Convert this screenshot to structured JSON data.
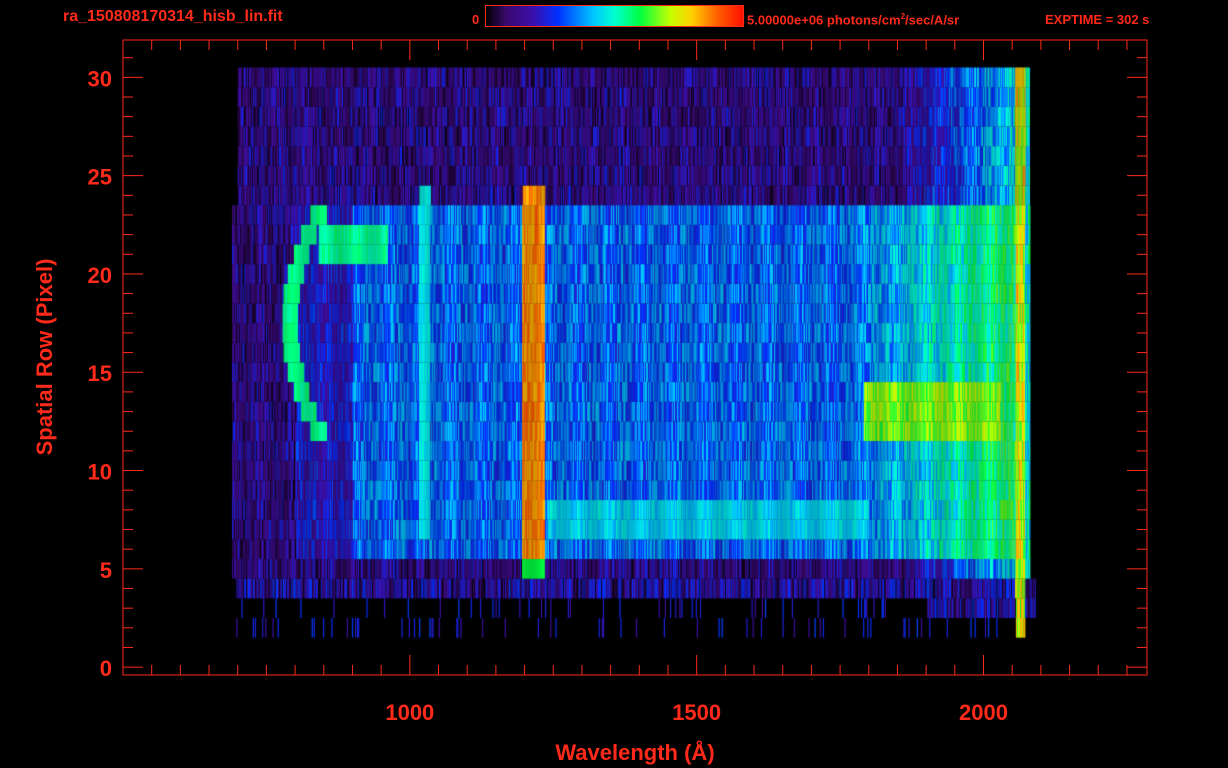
{
  "header": {
    "filename": "ra_150808170314_hisb_lin.fit",
    "colorbar_min": "0",
    "colorbar_max": "5.00000e+06 photons/cm",
    "colorbar_units_sup": "2",
    "colorbar_units_rest": "/sec/A/sr",
    "exptime": "EXPTIME = 302 s"
  },
  "chart_data": {
    "type": "heatmap",
    "title": "ra_150808170314_hisb_lin.fit",
    "xlabel": "Wavelength (Å)",
    "ylabel": "Spatial Row (Pixel)",
    "xlim": [
      500,
      2285
    ],
    "ylim": [
      -0.4,
      31.9
    ],
    "x_ticks": [
      1000,
      1500,
      2000
    ],
    "x_tick_labels": [
      "1000",
      "1500",
      "2000"
    ],
    "x_minor_step": 50,
    "y_ticks": [
      0,
      5,
      10,
      15,
      20,
      25,
      30
    ],
    "y_tick_labels": [
      "0",
      "5",
      "10",
      "15",
      "20",
      "25",
      "30"
    ],
    "color_range": [
      0,
      5000000
    ],
    "colormap": "rainbow",
    "rows": 31,
    "data_extent_wavelength": [
      690,
      2090
    ],
    "features": [
      {
        "name": "slit background",
        "wavelength": [
          690,
          2080
        ],
        "rows": [
          5,
          30
        ],
        "level": 0.15
      },
      {
        "name": "slit illuminated region",
        "wavelength": [
          780,
          2065
        ],
        "rows": [
          6,
          23
        ],
        "level": 0.36
      },
      {
        "name": "Lyman alpha 1216",
        "wavelength": [
          1195,
          1235
        ],
        "rows": [
          5,
          24
        ],
        "level": 0.92
      },
      {
        "name": "Lyman beta 1026",
        "wavelength": [
          1015,
          1035
        ],
        "rows": [
          7,
          24
        ],
        "level": 0.45
      },
      {
        "name": "arc feature",
        "wavelength": [
          780,
          960
        ],
        "rows": [
          12,
          23
        ],
        "level": 0.58
      },
      {
        "name": "row 7-8 band",
        "wavelength": [
          1240,
          1800
        ],
        "rows": [
          7,
          8
        ],
        "level": 0.45
      },
      {
        "name": "long-wave continuum",
        "wavelength": [
          1790,
          2060
        ],
        "rows": [
          6,
          23
        ],
        "level": 0.55
      },
      {
        "name": "bright rows 12-14",
        "wavelength": [
          1800,
          2030
        ],
        "rows": [
          12,
          14
        ],
        "level": 0.72
      },
      {
        "name": "detector edge",
        "wavelength": [
          2055,
          2072
        ],
        "rows": [
          2,
          30
        ],
        "level": 0.85
      }
    ],
    "colors": {
      "axis": "#ff2a1a",
      "background": "#000000"
    }
  }
}
